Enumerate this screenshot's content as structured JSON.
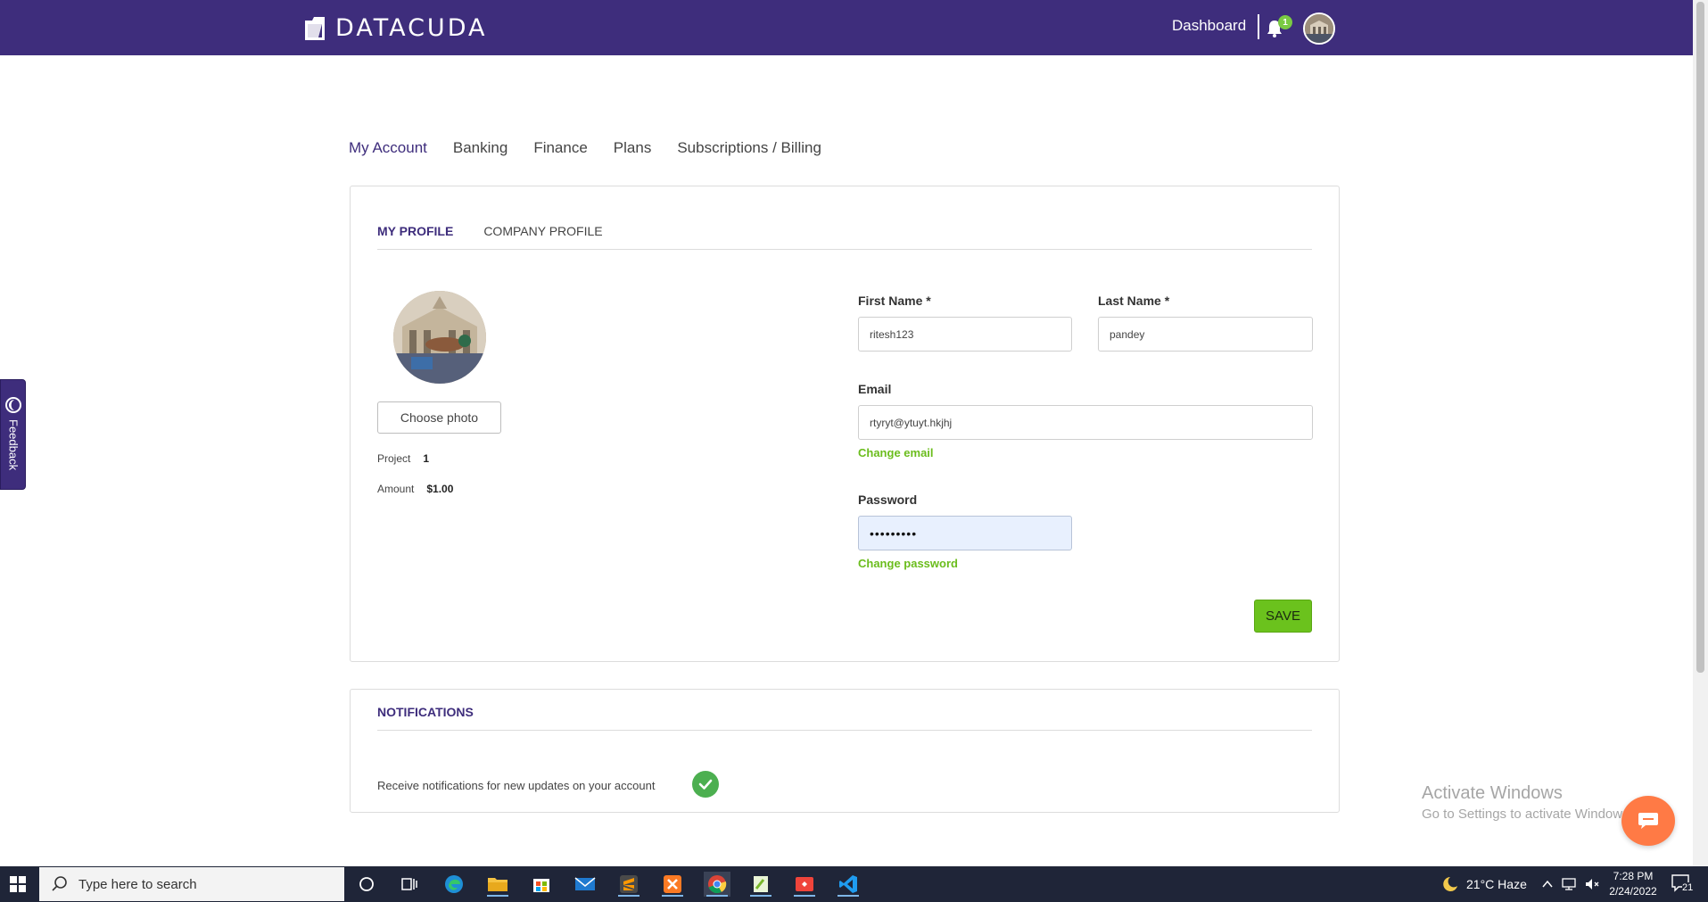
{
  "header": {
    "brand": "DATACUDA",
    "dashboard_label": "Dashboard",
    "notification_count": "1"
  },
  "account_tabs": [
    {
      "label": "My Account",
      "active": true
    },
    {
      "label": "Banking",
      "active": false
    },
    {
      "label": "Finance",
      "active": false
    },
    {
      "label": "Plans",
      "active": false
    },
    {
      "label": "Subscriptions / Billing",
      "active": false
    }
  ],
  "profile": {
    "tabs": [
      {
        "label": "MY PROFILE",
        "active": true
      },
      {
        "label": "COMPANY PROFILE",
        "active": false
      }
    ],
    "choose_photo_label": "Choose photo",
    "project_label": "Project",
    "project_value": "1",
    "amount_label": "Amount",
    "amount_value": "$1.00",
    "first_name_label": "First Name *",
    "first_name_value": "ritesh123",
    "last_name_label": "Last Name *",
    "last_name_value": "pandey",
    "email_label": "Email",
    "email_value": "rtyryt@ytuyt.hkjhj",
    "change_email_label": "Change email",
    "password_label": "Password",
    "password_value": "•••••••••",
    "change_password_label": "Change password",
    "save_label": "SAVE"
  },
  "notifications": {
    "title": "NOTIFICATIONS",
    "receive_updates_label": "Receive notifications for new updates on your account",
    "receive_updates_enabled": true
  },
  "feedback_label": "Feedback",
  "watermark": {
    "line1": "Activate Windows",
    "line2": "Go to Settings to activate Windows."
  },
  "taskbar": {
    "search_placeholder": "Type here to search",
    "weather": "21°C  Haze",
    "time": "7:28 PM",
    "date": "2/24/2022",
    "notification_count": "21"
  },
  "colors": {
    "brand_purple": "#3e2d7c",
    "accent_green": "#6bc21d",
    "taskbar": "#1f2538"
  }
}
